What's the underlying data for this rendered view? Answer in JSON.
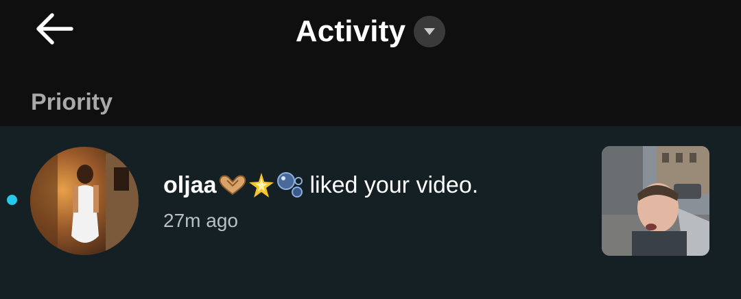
{
  "header": {
    "title": "Activity",
    "back_icon": "back-arrow-icon",
    "dropdown_icon": "chevron-down-icon"
  },
  "section": {
    "label": "Priority"
  },
  "notifications": [
    {
      "username": "oljaa",
      "username_emojis": [
        "heart-hands-icon",
        "sparkle-star-icon",
        "bubbles-icon"
      ],
      "action": "liked your video.",
      "time": "27m ago",
      "unread": true
    }
  ],
  "colors": {
    "background": "#0f0f0f",
    "row_background": "#142024",
    "unread_dot": "#27c9e8",
    "section_label": "#a9a9a9",
    "timestamp": "#b9c0c3"
  }
}
